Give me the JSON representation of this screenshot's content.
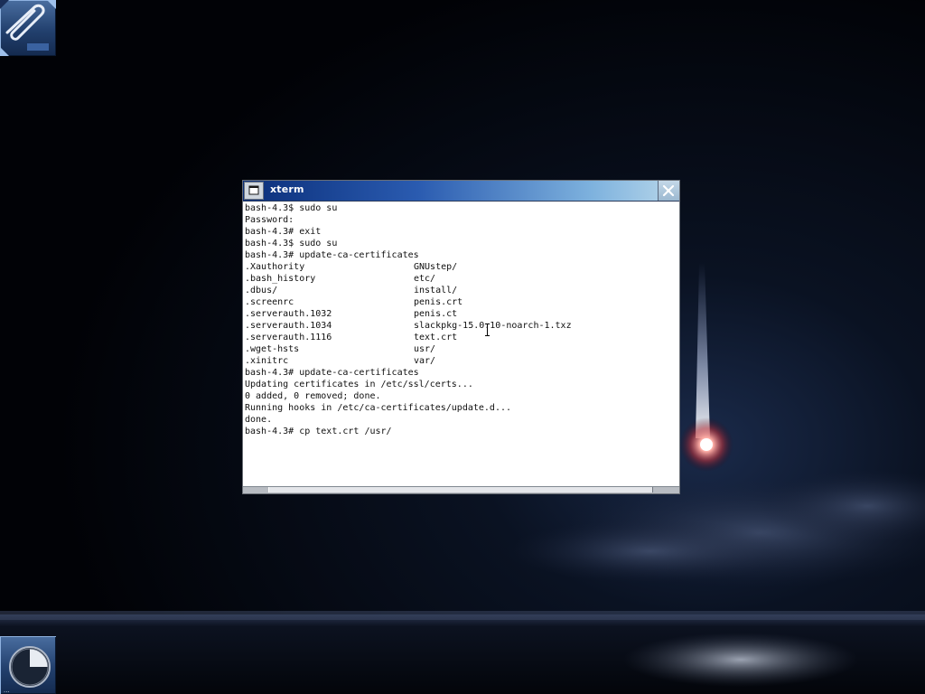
{
  "desktop": {
    "dock": {
      "mail_icon": "mail-icon",
      "clock_icon": "clock-icon"
    }
  },
  "window": {
    "title": "xterm",
    "menu_icon": "window-menu-icon",
    "close_icon": "close-icon"
  },
  "terminal": {
    "lines": [
      "bash-4.3$ sudo su",
      "Password:",
      "bash-4.3# exit",
      "bash-4.3$ sudo su",
      "bash-4.3# update-ca-certificates"
    ],
    "listing": [
      [
        ".Xauthority",
        "GNUstep/"
      ],
      [
        ".bash_history",
        "etc/"
      ],
      [
        ".dbus/",
        "install/"
      ],
      [
        ".screenrc",
        "penis.crt"
      ],
      [
        ".serverauth.1032",
        "penis.ct"
      ],
      [
        ".serverauth.1034",
        "slackpkg-15.0.10-noarch-1.txz"
      ],
      [
        ".serverauth.1116",
        "text.crt"
      ],
      [
        ".wget-hsts",
        "usr/"
      ],
      [
        ".xinitrc",
        "var/"
      ]
    ],
    "lines_after": [
      "bash-4.3# update-ca-certificates",
      "Updating certificates in /etc/ssl/certs...",
      "0 added, 0 removed; done.",
      "Running hooks in /etc/ca-certificates/update.d...",
      "done.",
      "bash-4.3# cp text.crt /usr/"
    ]
  },
  "colors": {
    "title_start": "#0b2f7a",
    "title_end": "#b8d7ea",
    "terminal_bg": "#ffffff",
    "terminal_fg": "#101010"
  }
}
